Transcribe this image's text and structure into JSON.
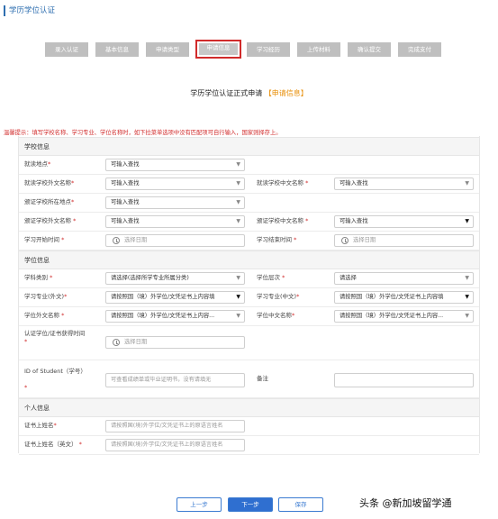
{
  "page": {
    "title": "学历学位认证"
  },
  "steps": [
    {
      "label": "录入认证",
      "active": false
    },
    {
      "label": "基本信息",
      "active": false
    },
    {
      "label": "申请类型",
      "active": false
    },
    {
      "label": "申请信息",
      "active": true
    },
    {
      "label": "学习经历",
      "active": false
    },
    {
      "label": "上传材料",
      "active": false
    },
    {
      "label": "确认提交",
      "active": false
    },
    {
      "label": "完成支付",
      "active": false
    }
  ],
  "form": {
    "title": "学历学位认证正式申请",
    "subtitle": "【申请信息】",
    "warning": "温馨提示：填写学校名称、学习专业、学位名称时，如下拉菜单选项中没有匹配项可自行输入，国家则择存上。"
  },
  "sections": {
    "school": "学校信息",
    "degree": "学位信息",
    "personal": "个人信息"
  },
  "labels": {
    "study_location": "就读地点",
    "school_foreign_name": "就读学校外文名称",
    "school_chinese_name": "就读学校中文名称",
    "issuing_school_location": "颁证学校所在地点",
    "issuing_school_foreign_name": "颁证学校外文名称",
    "issuing_school_chinese_name": "颁证学校中文名称",
    "study_start": "学习开始时间",
    "study_end": "学习结束时间",
    "discipline": "学科类别",
    "degree_level": "学位层次",
    "major_foreign": "学习专业(外文)",
    "major_chinese": "学习专业(中文)",
    "degree_foreign_name": "学位外文名称",
    "degree_chinese_name": "学位中文名称",
    "degree_obtained_time": "认证学位/证书获得时间",
    "student_id": "ID of Student（学号）",
    "remarks": "备注",
    "cert_name": "证书上姓名",
    "cert_name_en": "证书上姓名（英文）",
    "required_mark": "*"
  },
  "fields": {
    "searchable": "可输入查找",
    "select_date": "选择日期",
    "discipline_ph": "请选择(选择所学专业所属分类)",
    "degree_level_ph": "请选择",
    "major_foreign_val": "请按照国（境）外学位/文凭证书上内容填",
    "major_chinese_val": "请按照国（境）外学位/文凭证书上内容填",
    "degree_foreign_val": "请按照国（境）外学位/文凭证书上内容...",
    "degree_chinese_val": "请按照国（境）外学位/文凭证书上内容...",
    "student_id_ph": "可查看成绩单或毕业证明书，没有请填无",
    "cert_name_ph": "请按照国(境)外学位/文凭证书上的原语言姓名",
    "cert_name_en_ph": "请按照国(境)外学位/文凭证书上的原语言姓名"
  },
  "buttons": {
    "prev": "上一步",
    "next": "下一步",
    "save": "保存"
  },
  "watermark": "头条 @新加坡留学通"
}
